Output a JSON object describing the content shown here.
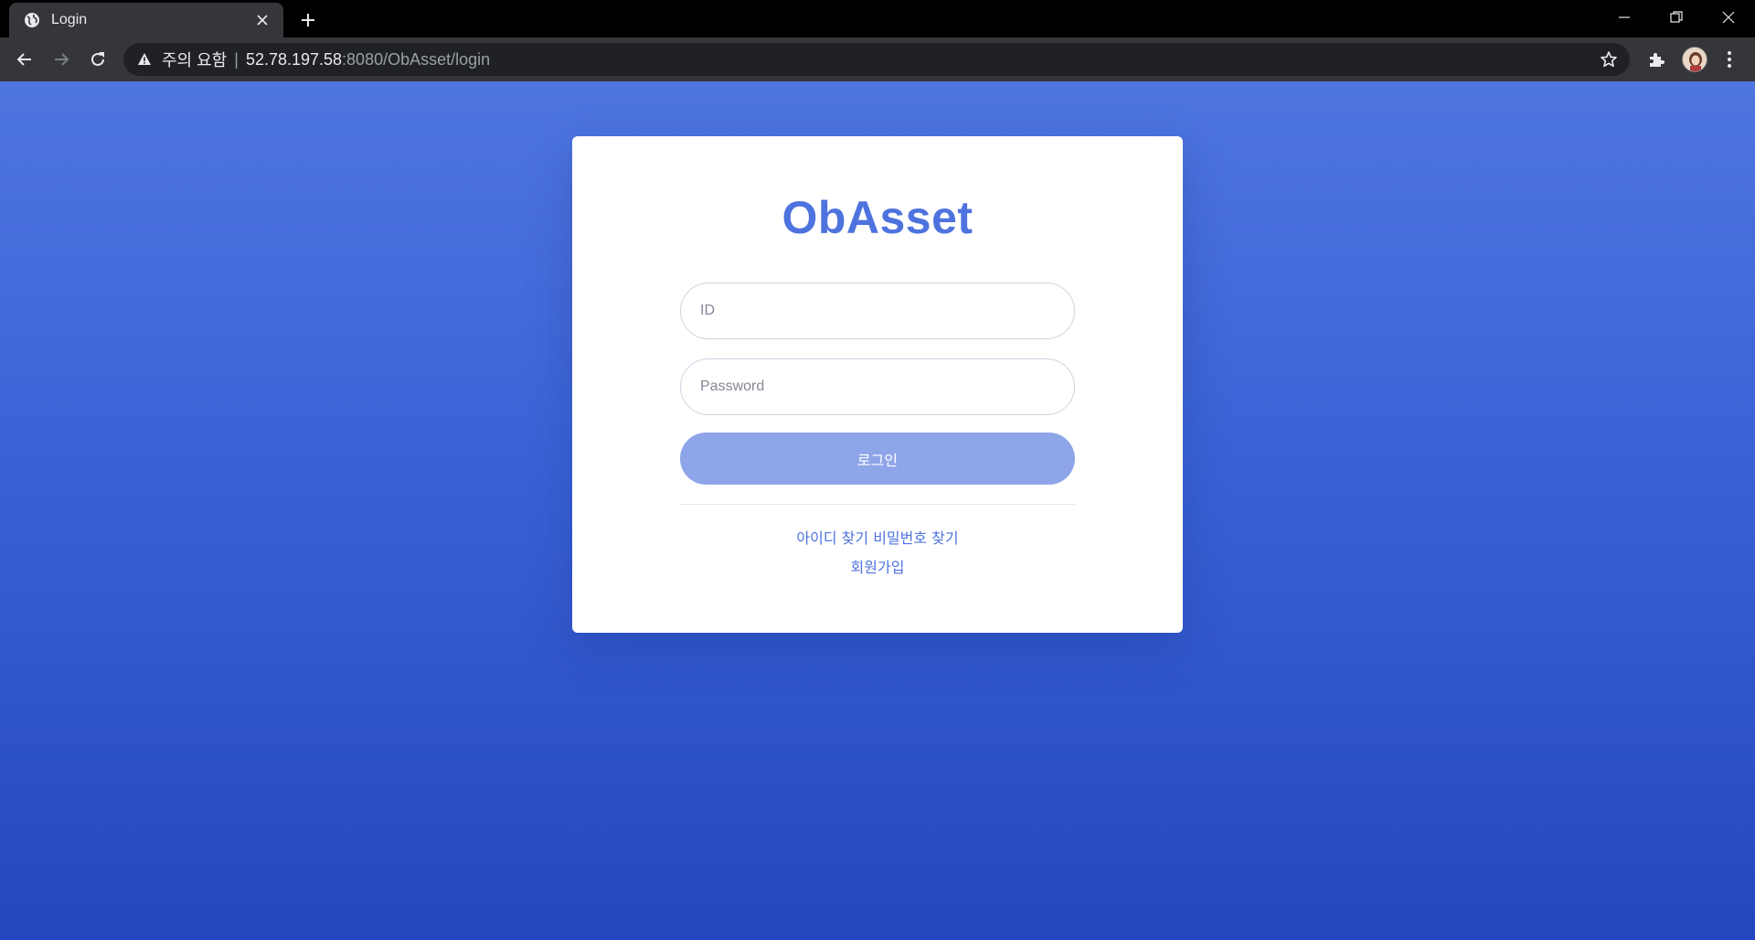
{
  "browser": {
    "tab_title": "Login",
    "security_label": "주의 요함",
    "url_host": "52.78.197.58",
    "url_rest": ":8080/ObAsset/login",
    "icons": [
      "globe-icon",
      "close-icon",
      "plus-icon",
      "minimize-icon",
      "restore-icon",
      "close-window-icon",
      "back-arrow-icon",
      "forward-arrow-icon",
      "reload-icon",
      "warning-icon",
      "star-icon",
      "puzzle-icon",
      "more-vert-icon"
    ]
  },
  "login": {
    "brand": "ObAsset",
    "id_placeholder": "ID",
    "password_placeholder": "Password",
    "submit_label": "로그인",
    "find_id": "아이디 찾기",
    "find_password": "비밀번호 찾기",
    "signup": "회원가입"
  },
  "colors": {
    "brand": "#4e73df",
    "button": "#8fa5ea",
    "background_top": "#4f76df",
    "background_bottom": "#2447bf"
  }
}
